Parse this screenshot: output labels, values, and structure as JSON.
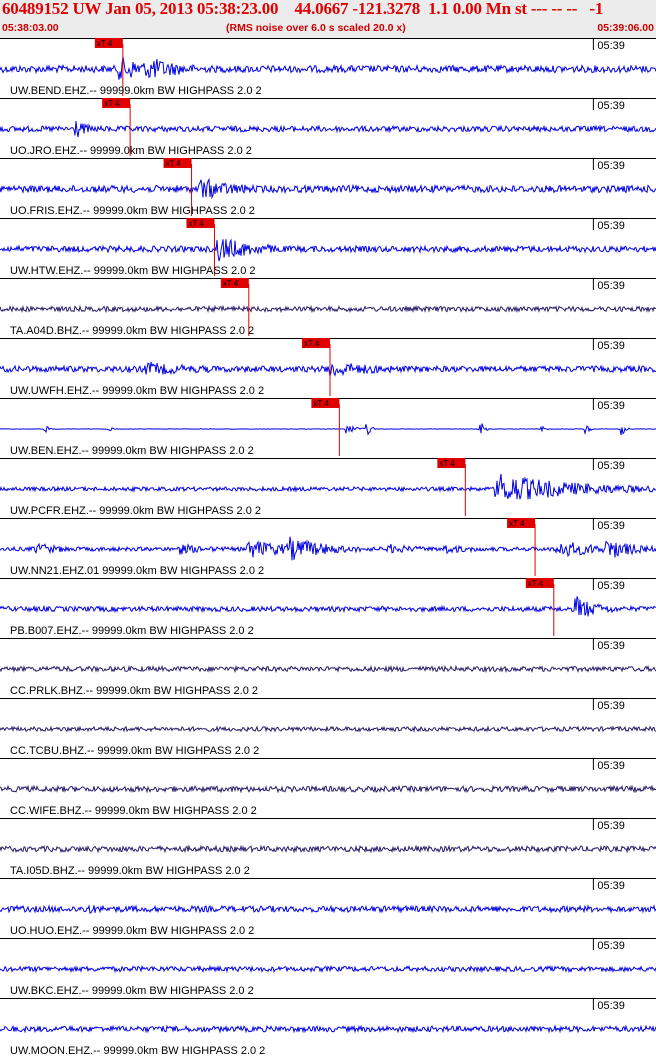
{
  "header": {
    "title": "60489152 UW Jan 05, 2013 05:38:23.00    44.0667 -121.3278  1.1 0.00 Mn st --- -- --   -1",
    "start_time": "05:38:03.00",
    "noise_note": "(RMS noise over 6.0 s scaled 20.0 x)",
    "end_time": "05:39:06.00"
  },
  "colors": {
    "trace_blue": "#0000e6",
    "trace_dark": "#2a1a6a",
    "pick_red": "#e00000",
    "title_red": "#e00000",
    "header_bg": "#ececec",
    "divider": "#000000"
  },
  "chart_data": {
    "type": "seismogram",
    "time_start": "05:38:03.00",
    "time_end": "05:39:06.00",
    "tick_label": "05:39",
    "tick_time_s": 57,
    "pick_label": "xT 4",
    "pick_phase": "P",
    "noise_window_s": 6.0,
    "scale_factor": 20.0,
    "traces": [
      {
        "label": "UW.BEND.EHZ.-- 99999.0km BW  HIGHPASS  2.0  2",
        "pick_s": 11.8,
        "color": "blue",
        "noise": 0.35,
        "events": [
          {
            "t": 11.5,
            "amp": 1.0,
            "dur": 2.5
          },
          {
            "t": 14.3,
            "amp": 0.6,
            "dur": 2.0
          }
        ]
      },
      {
        "label": "UO.JRO.EHZ.-- 99999.0km BW  HIGHPASS  2.0  2",
        "pick_s": 12.5,
        "color": "blue",
        "noise": 0.28,
        "events": [
          {
            "t": 7.3,
            "amp": 0.9,
            "dur": 0.6
          }
        ]
      },
      {
        "label": "UO.FRIS.EHZ.-- 99999.0km BW  HIGHPASS  2.0  2",
        "pick_s": 18.4,
        "color": "blue",
        "noise": 0.35,
        "events": [
          {
            "t": 19.3,
            "amp": 0.9,
            "dur": 2.0
          }
        ]
      },
      {
        "label": "UW.HTW.EHZ.-- 99999.0km BW  HIGHPASS  2.0  2",
        "pick_s": 20.6,
        "color": "blue",
        "noise": 0.3,
        "events": [
          {
            "t": 20.9,
            "amp": 1.1,
            "dur": 2.5
          }
        ]
      },
      {
        "label": "TA.A04D.BHZ.-- 99999.0km BW  HIGHPASS  2.0  2",
        "pick_s": 23.9,
        "color": "dark",
        "noise": 0.25,
        "events": []
      },
      {
        "label": "UW.UWFH.EHZ.-- 99999.0km BW  HIGHPASS  2.0  2",
        "pick_s": 31.7,
        "color": "blue",
        "noise": 0.3,
        "events": [
          {
            "t": 13.9,
            "amp": 0.5,
            "dur": 2.5
          },
          {
            "t": 31.5,
            "amp": 0.7,
            "dur": 2.5
          }
        ]
      },
      {
        "label": "UW.BEN.EHZ.-- 99999.0km BW  HIGHPASS  2.0  2",
        "pick_s": 32.6,
        "color": "blue",
        "noise": 0.02,
        "events": [
          {
            "t": 4.4,
            "amp": 0.35,
            "dur": 0.3
          },
          {
            "t": 10.5,
            "amp": 0.25,
            "dur": 0.3
          },
          {
            "t": 33.3,
            "amp": 0.6,
            "dur": 0.8
          },
          {
            "t": 35.3,
            "amp": 0.9,
            "dur": 0.3
          },
          {
            "t": 46.2,
            "amp": 0.8,
            "dur": 0.3
          },
          {
            "t": 52.1,
            "amp": 0.4,
            "dur": 0.3
          },
          {
            "t": 56.3,
            "amp": 0.8,
            "dur": 0.3
          },
          {
            "t": 59.7,
            "amp": 0.8,
            "dur": 0.3
          }
        ]
      },
      {
        "label": "UW.PCFR.EHZ.-- 99999.0km BW  HIGHPASS  2.0  2",
        "pick_s": 44.7,
        "color": "blue",
        "noise": 0.2,
        "events": [
          {
            "t": 47.7,
            "amp": 1.5,
            "dur": 6.0
          }
        ]
      },
      {
        "label": "UW.NN21.EHZ.01 99999.0km BW  HIGHPASS  2.0  2",
        "pick_s": 51.4,
        "color": "blue",
        "noise": 0.2,
        "events": [
          {
            "t": 3.5,
            "amp": 0.5,
            "dur": 1.5
          },
          {
            "t": 17.2,
            "amp": 0.4,
            "dur": 1.5
          },
          {
            "t": 23.8,
            "amp": 0.8,
            "dur": 3.5
          },
          {
            "t": 27.8,
            "amp": 0.8,
            "dur": 3.0
          },
          {
            "t": 37.4,
            "amp": 0.35,
            "dur": 1.5
          },
          {
            "t": 42.6,
            "amp": 0.35,
            "dur": 1.5
          },
          {
            "t": 53.6,
            "amp": 0.8,
            "dur": 3.0
          },
          {
            "t": 58.3,
            "amp": 0.8,
            "dur": 2.0
          }
        ]
      },
      {
        "label": "PB.B007.EHZ.-- 99999.0km BW  HIGHPASS  2.0  2",
        "pick_s": 53.2,
        "color": "blue",
        "noise": 0.25,
        "events": [
          {
            "t": 55.3,
            "amp": 1.2,
            "dur": 1.5
          }
        ]
      },
      {
        "label": "CC.PRLK.BHZ.-- 99999.0km BW  HIGHPASS  2.0  2",
        "pick_s": null,
        "color": "dark",
        "noise": 0.25,
        "events": []
      },
      {
        "label": "CC.TCBU.BHZ.-- 99999.0km BW  HIGHPASS  2.0  2",
        "pick_s": null,
        "color": "dark",
        "noise": 0.22,
        "events": []
      },
      {
        "label": "CC.WIFE.BHZ.-- 99999.0km BW  HIGHPASS  2.0  2",
        "pick_s": null,
        "color": "dark",
        "noise": 0.28,
        "events": []
      },
      {
        "label": "TA.I05D.BHZ.-- 99999.0km BW  HIGHPASS  2.0  2",
        "pick_s": null,
        "color": "dark",
        "noise": 0.28,
        "events": []
      },
      {
        "label": "UO.HUO.EHZ.-- 99999.0km BW  HIGHPASS  2.0  2",
        "pick_s": null,
        "color": "blue",
        "noise": 0.3,
        "events": [
          {
            "t": 8.3,
            "amp": 0.35,
            "dur": 0.6
          }
        ]
      },
      {
        "label": "UW.BKC.EHZ.-- 99999.0km BW  HIGHPASS  2.0  2",
        "pick_s": null,
        "color": "blue",
        "noise": 0.25,
        "events": []
      },
      {
        "label": "UW.MOON.EHZ.-- 99999.0km BW  HIGHPASS  2.0  2",
        "pick_s": null,
        "color": "blue",
        "noise": 0.28,
        "events": [
          {
            "t": 53.0,
            "amp": 0.5,
            "dur": 0.3
          }
        ]
      }
    ]
  }
}
